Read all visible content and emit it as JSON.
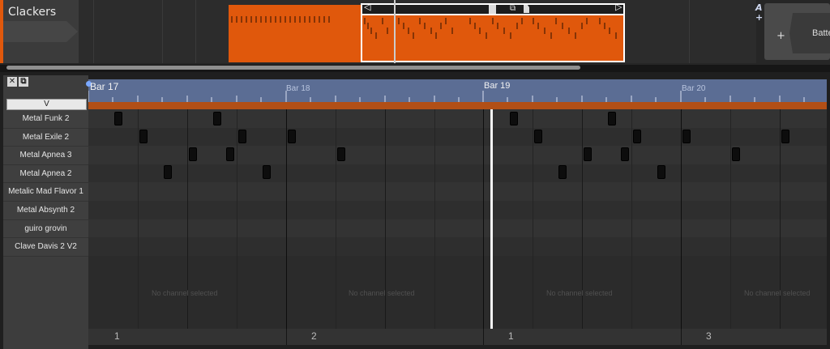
{
  "arranger": {
    "track_name": "Clackers",
    "device_label": "Batte",
    "ctrl_icons": [
      "A",
      "+"
    ]
  },
  "editor": {
    "velocity_box": "V",
    "channels": [
      "Metal Funk 2",
      "Metal Exile 2",
      "Metal Apnea 3",
      "Metal Apnea 2",
      "Metalic Mad Flavor 1",
      "Metal Absynth 2",
      "guiro grovin",
      "Clave Davis 2 V2"
    ],
    "bars": {
      "b17": "Bar 17",
      "b18": "Bar 18",
      "b19": "Bar 19",
      "b20": "Bar 20"
    },
    "empty_message": "No channel selected",
    "footer_numbers": [
      "1",
      "2",
      "1",
      "3"
    ]
  },
  "colors": {
    "clip_orange": "#e0580c",
    "ruler_blue": "#5b6d94"
  },
  "icons": {
    "close": "close-icon",
    "float": "float-window-icon",
    "plus": "plus-icon"
  }
}
